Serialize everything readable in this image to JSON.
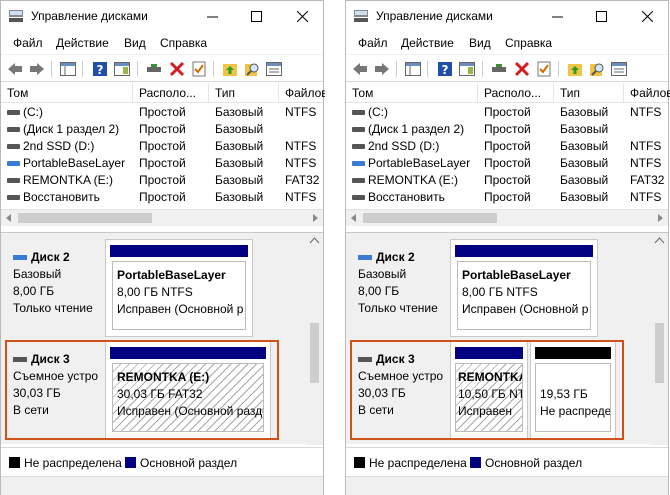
{
  "windows": [
    {
      "title": "Управление дисками",
      "menu": [
        "Файл",
        "Действие",
        "Вид",
        "Справка"
      ],
      "columns": [
        "Том",
        "Располо...",
        "Тип",
        "Файловая"
      ],
      "volumes": [
        {
          "name": "(C:)",
          "layout": "Простой",
          "type": "Базовый",
          "fs": "NTFS",
          "icon": "disk-icon"
        },
        {
          "name": "(Диск 1 раздел 2)",
          "layout": "Простой",
          "type": "Базовый",
          "fs": "",
          "icon": "disk-icon"
        },
        {
          "name": "2nd SSD (D:)",
          "layout": "Простой",
          "type": "Базовый",
          "fs": "NTFS",
          "icon": "disk-icon"
        },
        {
          "name": "PortableBaseLayer",
          "layout": "Простой",
          "type": "Базовый",
          "fs": "NTFS",
          "icon": "virtual-disk-icon"
        },
        {
          "name": "REMONTKA (E:)",
          "layout": "Простой",
          "type": "Базовый",
          "fs": "FAT32",
          "icon": "removable-disk-icon"
        },
        {
          "name": "Восстановить",
          "layout": "Простой",
          "type": "Базовый",
          "fs": "NTFS",
          "icon": "disk-icon"
        }
      ],
      "disk2": {
        "name": "Диск 2",
        "type": "Базовый",
        "size": "8,00 ГБ",
        "status": "Только чтение",
        "partition": {
          "name": "PortableBaseLayer",
          "size": "8,00 ГБ NTFS",
          "status": "Исправен (Основной р"
        }
      },
      "disk3": {
        "name": "Диск 3",
        "type": "Съемное устро",
        "size": "30,03 ГБ",
        "status": "В сети",
        "partitions": [
          {
            "name": "REMONTKA  (E:)",
            "size": "30,03 ГБ FAT32",
            "status": "Исправен (Основной разде"
          }
        ]
      },
      "legend": [
        "Не распределена",
        "Основной раздел"
      ]
    },
    {
      "title": "Управление дисками",
      "menu": [
        "Файл",
        "Действие",
        "Вид",
        "Справка"
      ],
      "columns": [
        "Том",
        "Располо...",
        "Тип",
        "Файловая"
      ],
      "volumes": [
        {
          "name": "(C:)",
          "layout": "Простой",
          "type": "Базовый",
          "fs": "NTFS",
          "icon": "disk-icon"
        },
        {
          "name": "(Диск 1 раздел 2)",
          "layout": "Простой",
          "type": "Базовый",
          "fs": "",
          "icon": "disk-icon"
        },
        {
          "name": "2nd SSD (D:)",
          "layout": "Простой",
          "type": "Базовый",
          "fs": "NTFS",
          "icon": "disk-icon"
        },
        {
          "name": "PortableBaseLayer",
          "layout": "Простой",
          "type": "Базовый",
          "fs": "NTFS",
          "icon": "virtual-disk-icon"
        },
        {
          "name": "REMONTKA (E:)",
          "layout": "Простой",
          "type": "Базовый",
          "fs": "FAT32",
          "icon": "removable-disk-icon"
        },
        {
          "name": "Восстановить",
          "layout": "Простой",
          "type": "Базовый",
          "fs": "NTFS",
          "icon": "disk-icon"
        }
      ],
      "disk2": {
        "name": "Диск 2",
        "type": "Базовый",
        "size": "8,00 ГБ",
        "status": "Только чтение",
        "partition": {
          "name": "PortableBaseLayer",
          "size": "8,00 ГБ NTFS",
          "status": "Исправен (Основной р"
        }
      },
      "disk3": {
        "name": "Диск 3",
        "type": "Съемное устро",
        "size": "30,03 ГБ",
        "status": "В сети",
        "partitions": [
          {
            "name": "REMONTKA",
            "size": "10,50 ГБ NT",
            "status": "Исправен"
          },
          {
            "name": "",
            "size": "19,53 ГБ",
            "status": "Не распреде"
          }
        ]
      },
      "legend": [
        "Не распределена",
        "Основной раздел"
      ]
    }
  ],
  "colors": {
    "primary": "#000080",
    "unallocated": "#000000",
    "highlight": "#d0511a"
  }
}
